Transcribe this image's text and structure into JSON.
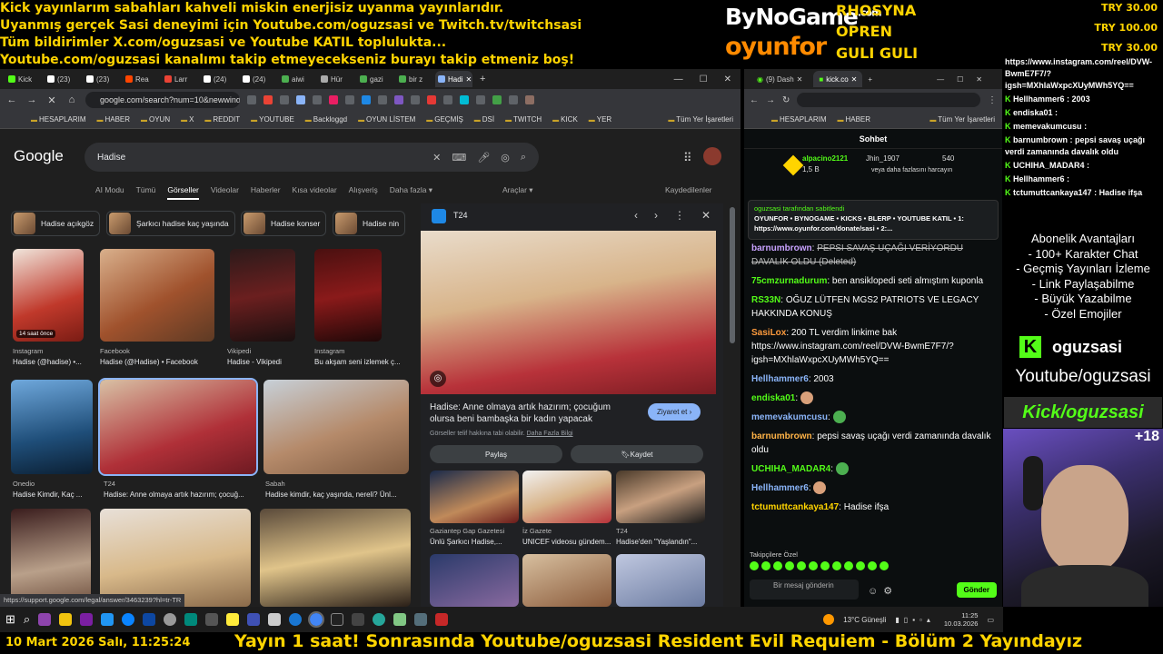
{
  "ticker": [
    "Kick yayınlarım sabahları kahveli miskin enerjisiz uyanma yayınlarıdır.",
    "Uyanmış gerçek Sasi deneyimi için Youtube.com/oguzsasi ve Twitch.tv/twitchsasi",
    "Tüm bildirimler X.com/oguzsasi ve Youtube KATIL toplulukta...",
    "Youtube.com/oguzsasi kanalımı takip etmeyecekseniz burayı takip etmeniz boş!"
  ],
  "brand": {
    "bynogame": "ByNoGame",
    "bynogame_sup": ".com",
    "oyunfor": "oyunfor"
  },
  "sponsors": [
    "RHOSYNA",
    "OPREN",
    "GULI GULI"
  ],
  "donations": [
    "TRY 30.00",
    "TRY 100.00",
    "TRY 30.00"
  ],
  "left_browser": {
    "tabs": [
      "Kick",
      "(23)",
      "(23)",
      "Rea",
      "Larr",
      "(24)",
      "(24)",
      "aiwi",
      "Hür",
      "gazi",
      "bir z",
      "Hadi"
    ],
    "url": "google.com/search?num=10&newwind...",
    "bookmarks": [
      "HESAPLARIM",
      "HABER",
      "OYUN",
      "X",
      "REDDIT",
      "YOUTUBE",
      "Backloggd",
      "OYUN LİSTEM",
      "GEÇMİŞ",
      "DSİ",
      "TWITCH",
      "KICK",
      "YER"
    ],
    "bookmarks_other": "Tüm Yer İşaretleri",
    "status_url": "https://support.google.com/legal/answer/3463239?hl=tr-TR"
  },
  "google": {
    "logo": "Google",
    "query": "Hadise",
    "nav": [
      "AI Modu",
      "Tümü",
      "Görseller",
      "Videolar",
      "Haberler",
      "Kısa videolar",
      "Alışveriş",
      "Daha fazla ▾"
    ],
    "tools": "Araçlar ▾",
    "saved": "Kaydedilenler",
    "chips": [
      "Hadise açıkgöz",
      "Şarkıcı hadise kaç yaşında",
      "Hadise konser",
      "Hadise nin"
    ],
    "results": [
      {
        "source": "Instagram",
        "title": "Hadise (@hadise) •...",
        "badge": "14 saat önce"
      },
      {
        "source": "Facebook",
        "title": "Hadise (@Hadise) • Facebook"
      },
      {
        "source": "Vikipedi",
        "title": "Hadise - Vikipedi"
      },
      {
        "source": "Instagram",
        "title": "Bu akşam seni izlemek ç..."
      },
      {
        "source": "Onedio",
        "title": "Hadise Kimdir, Kaç ..."
      },
      {
        "source": "T24",
        "title": "Hadise: Anne olmaya artık hazırım; çocuğ..."
      },
      {
        "source": "Sabah",
        "title": "Hadise kimdir, kaç yaşında, nereli? Ünl..."
      }
    ],
    "panel": {
      "source": "T24",
      "title": "Hadise: Anne olmaya artık hazırım; çocuğum olursa beni bambaşka bir kadın yapacak",
      "visit": "Ziyaret et ›",
      "note": "Görseller telif hakkına tabi olabilir.",
      "note_link": "Daha Fazla Bilgi",
      "share": "Paylaş",
      "save": "Kaydet",
      "related": [
        {
          "source": "Gaziantep Gap Gazetesi",
          "title": "Ünlü Şarkıcı Hadise,..."
        },
        {
          "source": "İz Gazete",
          "title": "UNICEF videosu gündem..."
        },
        {
          "source": "T24",
          "title": "Hadise'den \"Yaşlandın\"..."
        }
      ]
    }
  },
  "kick_browser": {
    "tabs": [
      "(9) Dash",
      "kick.co"
    ],
    "bookmarks": [
      "HESAPLARIM",
      "HABER"
    ],
    "bookmarks_other": "Tüm Yer İşaretleri",
    "header": "Sohbet",
    "gift": {
      "user1": "alpacino2121",
      "amount1": "1,5 B",
      "user2": "Jhin_1907",
      "count2": "540",
      "note": "veya daha fazlasını harcayın"
    },
    "pinned_by": "oguzsasi tarafından sabitlendi",
    "pinned_text": "OYUNFOR • BYNOGAME • KICKS • BLERP • YOUTUBE KATIL • 1: https://www.oyunfor.com/donate/sasi • 2:...",
    "messages": [
      {
        "user": "barnumbrown",
        "color": "#c8a2ff",
        "text": "PEPSI SAVAŞ UÇAĞI VERİYORDU DAVALIK OLDU (Deleted)"
      },
      {
        "user": "75cmzurnadurum",
        "color": "#53fc18",
        "text": "ben ansiklopedi seti almıştım kuponla"
      },
      {
        "user": "RS33N",
        "color": "#53fc18",
        "text": "OĞUZ LÜTFEN MGS2 PATRIOTS VE LEGACY HAKKINDA KONUŞ"
      },
      {
        "user": "SasiLox",
        "color": "#ff9b3d",
        "text": "200 TL verdim linkime bak https://www.instagram.com/reel/DVW-BwmE7F7/?igsh=MXhlaWxpcXUyMWh5YQ=="
      },
      {
        "user": "Hellhammer6",
        "color": "#8ab4f8",
        "text": "2003"
      },
      {
        "user": "endiska01",
        "color": "#53fc18",
        "text": ""
      },
      {
        "user": "memevakumcusu",
        "color": "#8ab4f8",
        "text": ""
      },
      {
        "user": "barnumbrown",
        "color": "#ffb347",
        "text": "pepsi savaş uçağı verdi zamanında davalık oldu"
      },
      {
        "user": "UCHIHA_MADAR4",
        "color": "#53fc18",
        "text": ""
      },
      {
        "user": "Hellhammer6",
        "color": "#8ab4f8",
        "text": ""
      },
      {
        "user": "tctumuttcankaya147",
        "color": "#ffd400",
        "text": "Hadise ifşa"
      }
    ],
    "followers_only": "Takipçilere Özel",
    "input_placeholder": "Bir mesaj gönderin",
    "send": "Gönder"
  },
  "overlay_chat": [
    {
      "user": "",
      "text": "https://www.instagram.com/reel/DVW-BwmE7F7/?igsh=MXhlaWxpcXUyMWh5YQ=="
    },
    {
      "user": "Hellhammer6",
      "text": "2003"
    },
    {
      "user": "endiska01",
      "text": ""
    },
    {
      "user": "memevakumcusu",
      "text": ""
    },
    {
      "user": "barnumbrown",
      "text": "pepsi savaş uçağı verdi zamanında davalık oldu"
    },
    {
      "user": "UCHIHA_MADAR4",
      "text": ""
    },
    {
      "user": "Hellhammer6",
      "text": ""
    },
    {
      "user": "tctumuttcankaya147",
      "text": "Hadise ifşa"
    }
  ],
  "perks": [
    "Abonelik Avantajları",
    "- 100+ Karakter Chat",
    "- Geçmiş Yayınları İzleme",
    "- Link Paylaşabilme",
    "- Büyük Yazabilme",
    "- Özel Emojiler"
  ],
  "kick_name": "oguzsasi",
  "youtube": "Youtube/oguzsasi",
  "kick_banner": "Kick/oguzsasi",
  "cam_count": "+18",
  "taskbar": {
    "weather": "13°C  Güneşli",
    "time": "11:25",
    "date": "10.03.2026"
  },
  "bottom": {
    "date": "10 Mart 2026 Salı, 11:25:24",
    "scroll": "Yayın 1 saat! Sonrasında Youtube/oguzsasi Resident Evil Requiem - Bölüm 2 Yayındayız"
  },
  "colors": {
    "kick_green": "#53fc18",
    "ticker_yellow": "#ffd400",
    "google_bg": "#1f1f1f"
  }
}
